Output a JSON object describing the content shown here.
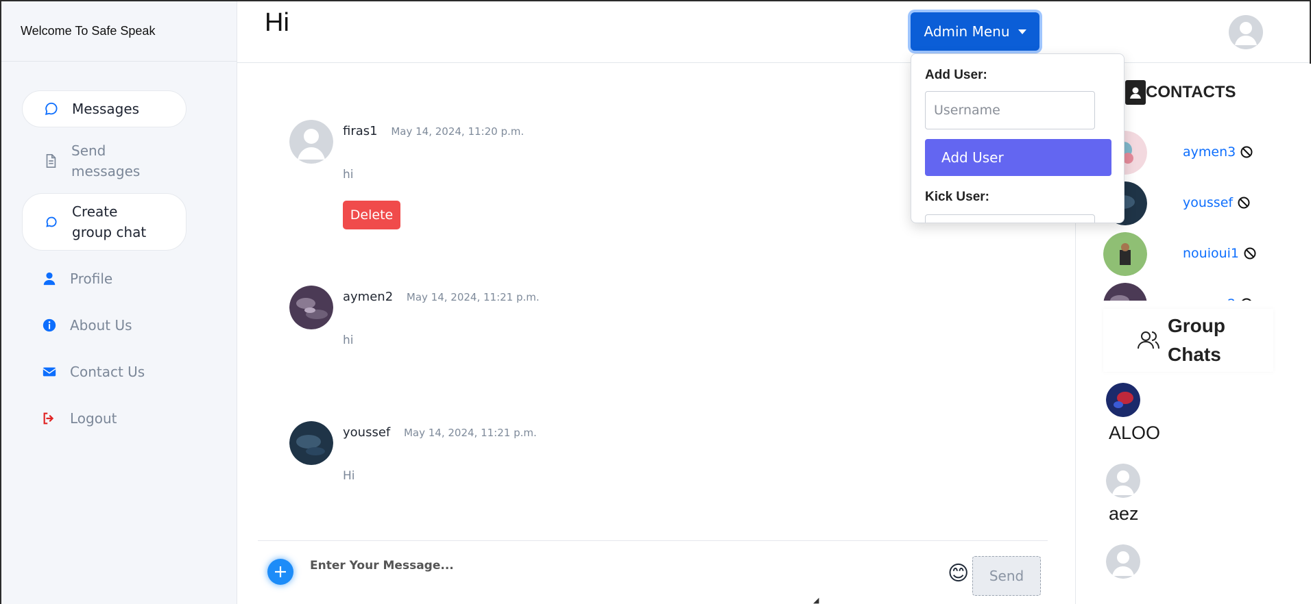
{
  "brand": "Welcome To Safe Speak",
  "sidebar": {
    "items": [
      {
        "label": "Messages",
        "icon": "chat-bubble-icon"
      },
      {
        "label": "Send messages",
        "icon": "document-icon"
      },
      {
        "label": "Create group chat",
        "icon": "chat-bubble-icon"
      },
      {
        "label": "Profile",
        "icon": "person-icon"
      },
      {
        "label": "About Us",
        "icon": "info-icon"
      },
      {
        "label": "Contact Us",
        "icon": "envelope-icon"
      },
      {
        "label": "Logout",
        "icon": "logout-icon"
      }
    ]
  },
  "header": {
    "greeting": "Hi",
    "admin_menu_label": "Admin Menu"
  },
  "admin_menu": {
    "add_user_label": "Add User:",
    "username_placeholder": "Username",
    "add_user_button": "Add User",
    "kick_user_label": "Kick User:"
  },
  "messages": [
    {
      "user": "firas1",
      "time": "May 14, 2024, 11:20 p.m.",
      "text": "hi",
      "delete_label": "Delete"
    },
    {
      "user": "aymen2",
      "time": "May 14, 2024, 11:21 p.m.",
      "text": "hi"
    },
    {
      "user": "youssef",
      "time": "May 14, 2024, 11:21 p.m.",
      "text": "Hi"
    }
  ],
  "composer": {
    "placeholder": "Enter Your Message...",
    "send_label": "Send",
    "emoji": "😊"
  },
  "contacts": {
    "title": "CONTACTS",
    "items": [
      {
        "name": "aymen3"
      },
      {
        "name": "youssef"
      },
      {
        "name": "nouioui1"
      },
      {
        "name": "aymen2"
      }
    ]
  },
  "group_chats": {
    "title": "Group Chats",
    "items": [
      {
        "name": "ALOO"
      },
      {
        "name": "aez"
      },
      {
        "name": ""
      }
    ]
  },
  "colors": {
    "primary": "#0b5ed7",
    "accent_purple": "#6366f1",
    "danger": "#f04b4b",
    "link": "#0d6efd"
  }
}
